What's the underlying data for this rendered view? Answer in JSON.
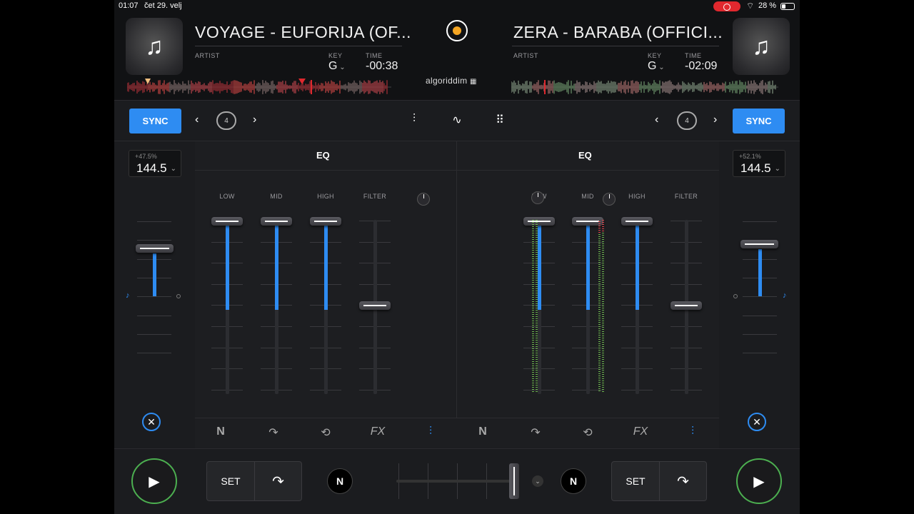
{
  "status_bar": {
    "time": "01:07",
    "date": "čet 29. velj",
    "battery_pct": "28 %"
  },
  "deck_a": {
    "title": "VOYAGE - EUFORIJA (OF...",
    "artist_label": "ARTIST",
    "key_label": "KEY",
    "key": "G",
    "time_label": "TIME",
    "time": "-00:38",
    "sync": "SYNC",
    "loop_beats": "4",
    "bpm_pct": "+47.5%",
    "bpm": "144.5",
    "eq_title": "EQ",
    "eq_labels": [
      "LOW",
      "MID",
      "HIGH",
      "FILTER"
    ]
  },
  "deck_b": {
    "title": "ZERA - BARABA (OFFICI...",
    "artist_label": "ARTIST",
    "key_label": "KEY",
    "key": "G",
    "time_label": "TIME",
    "time": "-02:09",
    "sync": "SYNC",
    "loop_beats": "4",
    "bpm_pct": "+52.1%",
    "bpm": "144.5",
    "eq_title": "EQ",
    "eq_labels": [
      "LOW",
      "MID",
      "HIGH",
      "FILTER"
    ]
  },
  "brand": "algoriddim",
  "bottom": {
    "set_a": "SET",
    "set_b": "SET"
  },
  "footer_icons": [
    "N",
    "↷",
    "⟲",
    "FX",
    "⫶"
  ],
  "colors": {
    "accent": "#2e8cf2",
    "play_ring": "#4caf50",
    "record": "#e0282e"
  }
}
